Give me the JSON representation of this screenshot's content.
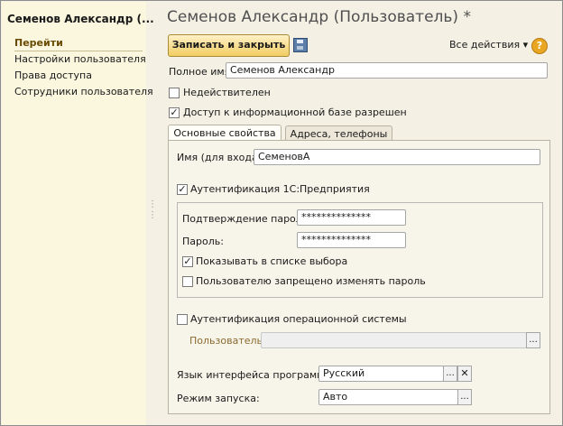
{
  "window": {
    "title": "Семенов Александр (Пользователь) *"
  },
  "left": {
    "title": "Семенов Александр (...",
    "goto_label": "Перейти",
    "items": [
      "Настройки пользователя",
      "Права доступа",
      "Сотрудники пользователя"
    ]
  },
  "toolbar": {
    "save_close": "Записать и закрыть",
    "save_icon": "floppy-disk-icon",
    "all_actions": "Все действия ▾",
    "help": "?"
  },
  "form": {
    "full_name_label": "Полное имя:",
    "full_name_value": "Семенов Александр",
    "invalid_label": "Недействителен",
    "access_label": "Доступ к информационной базе разрешен",
    "tabs": [
      "Основные свойства",
      "Адреса, телефоны"
    ],
    "login_label": "Имя (для входа):",
    "login_value": "СеменовА",
    "auth_1c_label": "Аутентификация 1С:Предприятия",
    "confirm_password_label": "Подтверждение пароля:",
    "confirm_password_value": "**************",
    "password_label": "Пароль:",
    "password_value": "**************",
    "show_in_list_label": "Показывать в списке выбора",
    "forbid_change_label": "Пользователю запрещено изменять пароль",
    "os_auth_label": "Аутентификация операционной системы",
    "os_user_label": "Пользователь:",
    "os_user_value": "",
    "lang_label": "Язык интерфейса программы:",
    "lang_value": "Русский",
    "launch_label": "Режим запуска:",
    "launch_value": "Авто",
    "select_button": "...",
    "clear_button": "✕",
    "check_mark": "✓",
    "dots": "⋮"
  },
  "colors": {
    "panel_bg": "#fbf7df",
    "accent_button": "#f1cd62",
    "title_text": "#4f4f4f"
  }
}
